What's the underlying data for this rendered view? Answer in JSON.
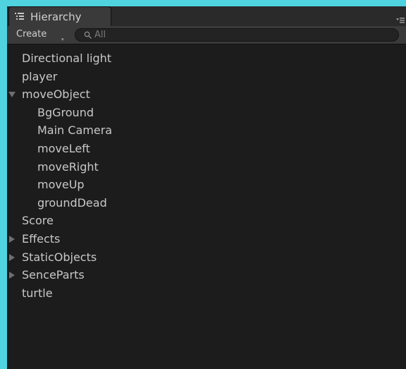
{
  "window": {
    "tab_label": "Hierarchy",
    "tab_icon": "hierarchy-list-icon",
    "menu_icon": "panel-menu-icon"
  },
  "toolbar": {
    "create_label": "Create",
    "create_arrow": "▾",
    "search_icon": "search-icon",
    "search_placeholder": "All"
  },
  "tree": {
    "items": [
      {
        "label": "Directional light",
        "depth": 0,
        "expander": "none"
      },
      {
        "label": "player",
        "depth": 0,
        "expander": "none"
      },
      {
        "label": "moveObject",
        "depth": 0,
        "expander": "expanded"
      },
      {
        "label": "BgGround",
        "depth": 1,
        "expander": "none"
      },
      {
        "label": "Main Camera",
        "depth": 1,
        "expander": "none"
      },
      {
        "label": "moveLeft",
        "depth": 1,
        "expander": "none"
      },
      {
        "label": "moveRight",
        "depth": 1,
        "expander": "none"
      },
      {
        "label": "moveUp",
        "depth": 1,
        "expander": "none"
      },
      {
        "label": "groundDead",
        "depth": 1,
        "expander": "none"
      },
      {
        "label": "Score",
        "depth": 0,
        "expander": "none"
      },
      {
        "label": "Effects",
        "depth": 0,
        "expander": "collapsed"
      },
      {
        "label": "StaticObjects",
        "depth": 0,
        "expander": "collapsed"
      },
      {
        "label": "SenceParts",
        "depth": 0,
        "expander": "collapsed"
      },
      {
        "label": "turtle",
        "depth": 0,
        "expander": "none"
      }
    ]
  }
}
